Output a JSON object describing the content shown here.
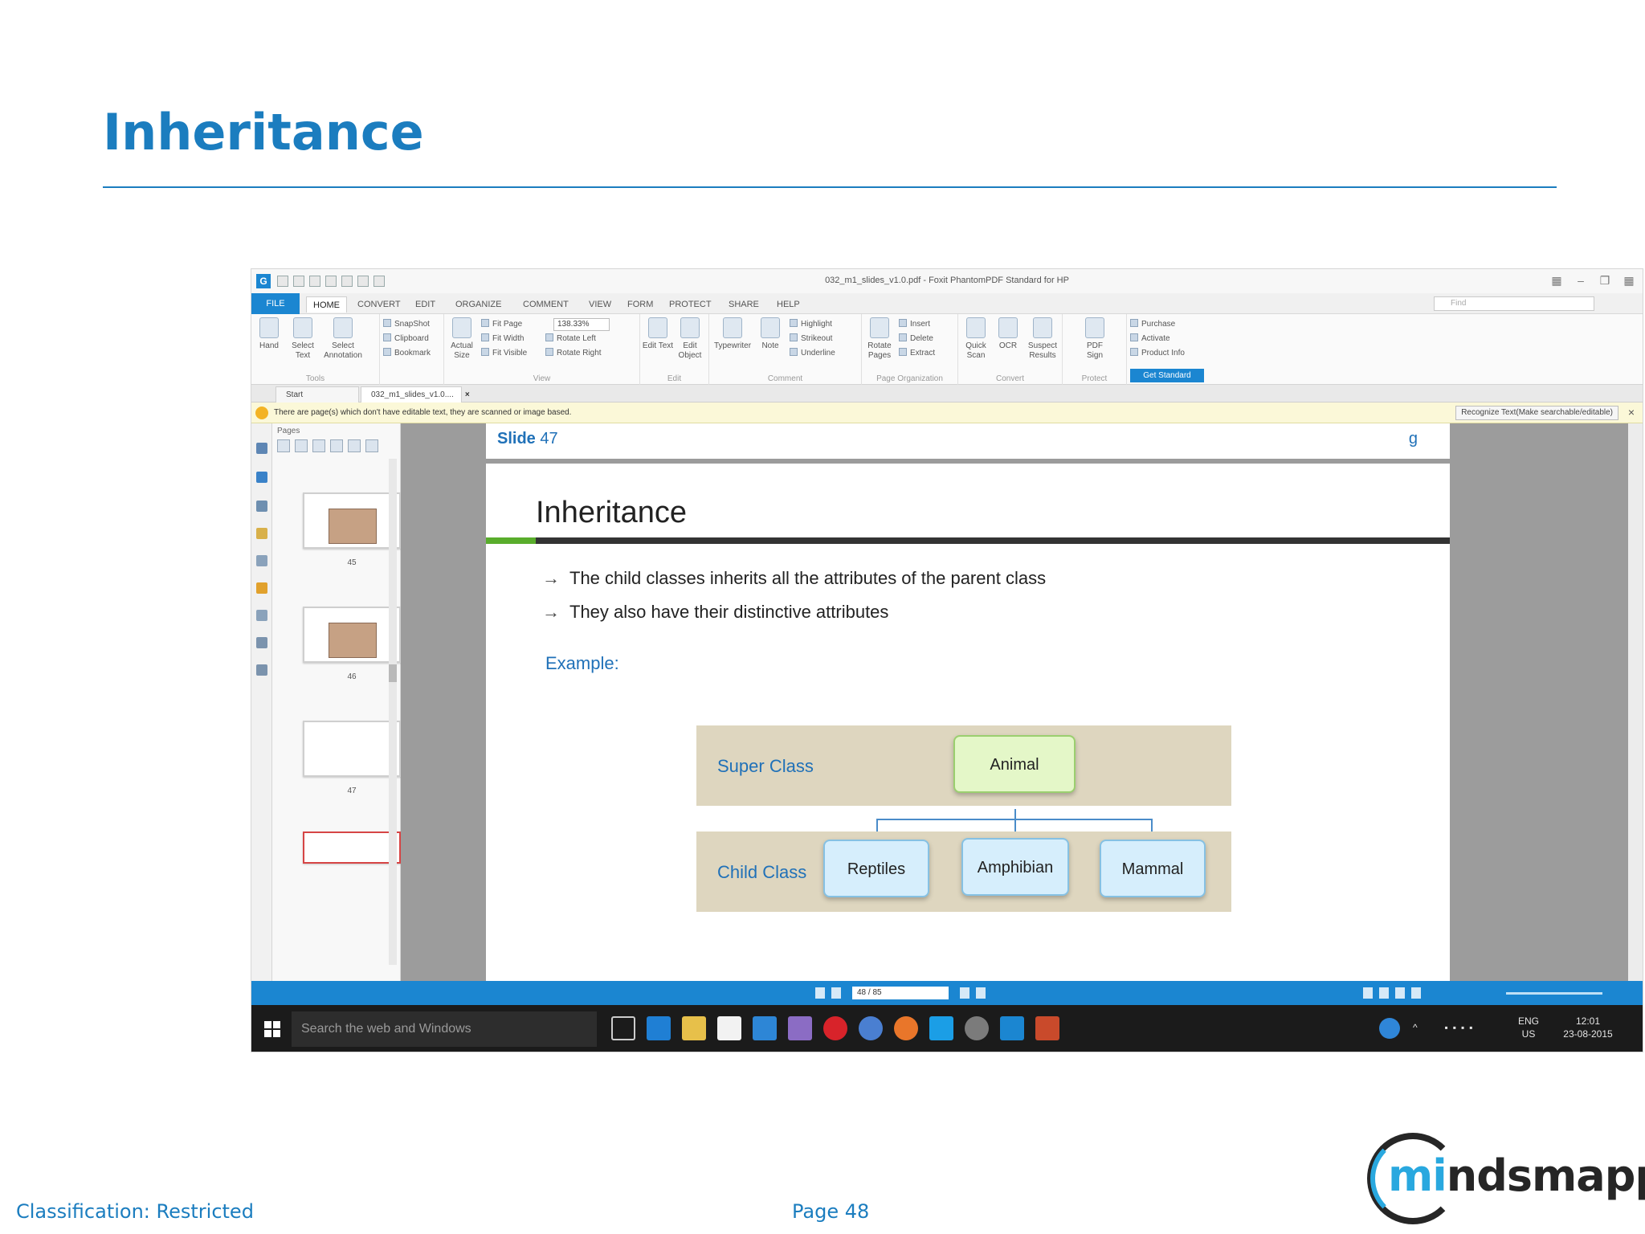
{
  "slide": {
    "title": "Inheritance",
    "footer_classification": "Classification: Restricted",
    "footer_page": "Page 48",
    "logo_text_a": "mi",
    "logo_text_b": "ndsmapped"
  },
  "colors": {
    "title_blue": "#1b7dbf",
    "app_blue": "#1b86d1",
    "super_box": "#e4f7c8",
    "child_box": "#d6eefc",
    "band": "#ded6bf"
  },
  "app": {
    "window_title": "032_m1_slides_v1.0.pdf - Foxit PhantomPDF Standard for HP",
    "menu": [
      "FILE",
      "HOME",
      "CONVERT",
      "EDIT",
      "ORGANIZE",
      "COMMENT",
      "VIEW",
      "FORM",
      "PROTECT",
      "SHARE",
      "HELP"
    ],
    "active_menu": "HOME",
    "find_placeholder": "Find",
    "ribbon": {
      "hand": "Hand",
      "select_text": "Select Text",
      "select_annotation": "Select Annotation",
      "snapshot": "SnapShot",
      "clipboard": "Clipboard",
      "bookmark": "Bookmark",
      "tools_label": "Tools",
      "actual_size": "Actual Size",
      "fit_page": "Fit Page",
      "fit_width": "Fit Width",
      "fit_visible": "Fit Visible",
      "zoom_value": "138.33%",
      "rotate_left": "Rotate Left",
      "rotate_right": "Rotate Right",
      "view_label": "View",
      "edit_text": "Edit Text",
      "edit_object": "Edit Object",
      "edit_label": "Edit",
      "typewriter": "Typewriter",
      "note": "Note",
      "highlight": "Highlight",
      "strikeout": "Strikeout",
      "underline": "Underline",
      "comment_label": "Comment",
      "rotate_pages": "Rotate Pages",
      "insert": "Insert",
      "delete": "Delete",
      "extract": "Extract",
      "page_org_label": "Page Organization",
      "quick_scan": "Quick Scan",
      "ocr": "OCR",
      "suspect_results": "Suspect Results",
      "convert_label": "Convert",
      "pdf_sign": "PDF Sign",
      "protect_label": "Protect",
      "purchase": "Purchase",
      "activate": "Activate",
      "product_info": "Product Info",
      "get_standard": "Get Standard"
    },
    "tabs": {
      "start": "Start",
      "doc": "032_m1_slides_v1.0...."
    },
    "infobar": {
      "message": "There are page(s) which don't have editable text, they are scanned or image based.",
      "button": "Recognize Text(Make searchable/editable)"
    },
    "pages_panel": {
      "label": "Pages",
      "thumbs": [
        "45",
        "46",
        "47"
      ]
    },
    "status": {
      "page_indicator": "48 / 85"
    }
  },
  "embedded_slide": {
    "slide_label": "Slide",
    "slide_number": "47",
    "corner_fragment": "g",
    "title": "Inheritance",
    "bullets": [
      "The child classes inherits all the attributes of the parent class",
      "They also have their distinctive attributes"
    ],
    "example_label": "Example:",
    "super_class_label": "Super Class",
    "child_class_label": "Child Class",
    "super_class": "Animal",
    "children": [
      "Reptiles",
      "Amphibian",
      "Mammal"
    ]
  },
  "taskbar": {
    "search_placeholder": "Search the web and Windows",
    "language": "ENG",
    "region": "US",
    "time": "12:01",
    "date": "23-08-2015"
  }
}
